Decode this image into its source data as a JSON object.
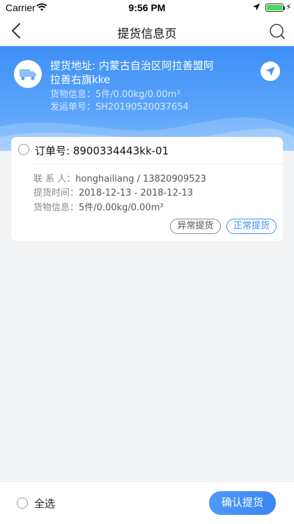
{
  "status_bar": {
    "carrier": "Carrier",
    "time": "9:56 PM"
  },
  "nav": {
    "title": "提货信息页",
    "back_icon": "chevron-left-icon",
    "search_icon": "search-icon"
  },
  "header": {
    "address_label": "提货地址: 内蒙古自治区阿拉善盟阿拉善右旗kke",
    "cargo_info": "货物信息：5件/0.00kg/0.00m³",
    "shipment_no": "发运单号：SH20190520037654",
    "truck_icon": "truck-icon",
    "navigate_icon": "navigation-arrow-icon",
    "colors": {
      "primary": "#3d8ff5",
      "light": "#78b6fc"
    }
  },
  "order": {
    "order_no": "订单号: 8900334443kk-01",
    "contact_label": "联 系 人：",
    "contact_value": "honghailiang / 13820909523",
    "pickup_time_label": "提货时间：",
    "pickup_time_value": "2018-12-13 - 2018-12-13",
    "cargo_label": "货物信息：",
    "cargo_value": "5件/0.00kg/0.00m³",
    "btn_abnormal": "异常提货",
    "btn_normal": "正常提货"
  },
  "bottom": {
    "select_all": "全选",
    "confirm": "确认提货"
  }
}
